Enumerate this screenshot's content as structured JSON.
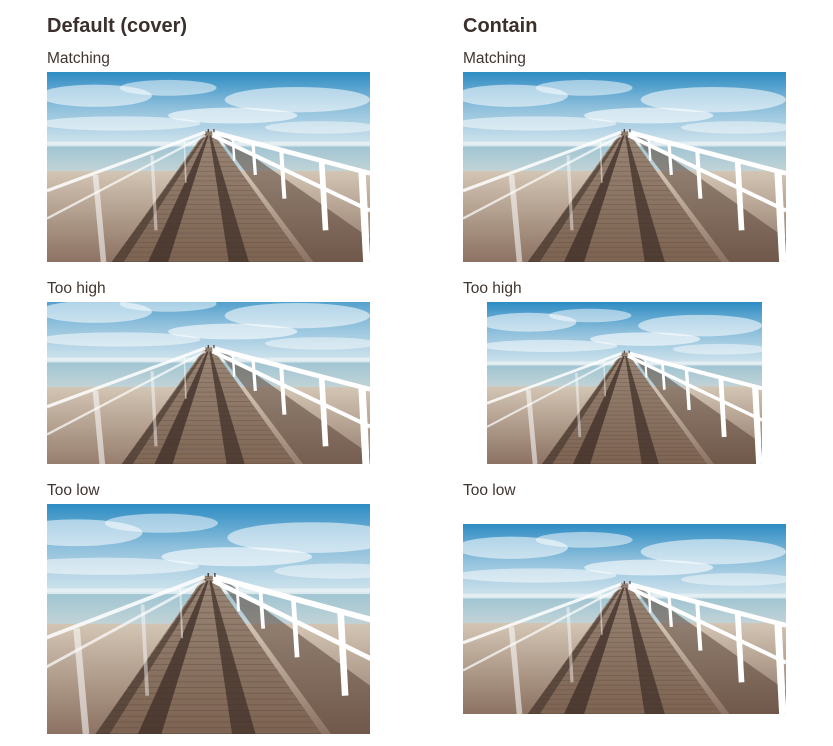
{
  "columns": [
    {
      "title": "Default (cover)",
      "cases": [
        {
          "label": "Matching"
        },
        {
          "label": "Too high"
        },
        {
          "label": "Too low"
        }
      ]
    },
    {
      "title": "Contain",
      "cases": [
        {
          "label": "Matching"
        },
        {
          "label": "Too high"
        },
        {
          "label": "Too low"
        }
      ]
    }
  ],
  "photo": {
    "alt": "Pier",
    "colors": {
      "sky_top": "#2f8fc4",
      "sky_mid": "#a9cde3",
      "horizon": "#dbe9ef",
      "sea": "#8fb8c8",
      "sand_light": "#c9b7a3",
      "sand_dark": "#8a6f5c",
      "deck_light": "#b49b85",
      "deck_dark": "#4a3a32",
      "rail": "#ffffff"
    }
  }
}
